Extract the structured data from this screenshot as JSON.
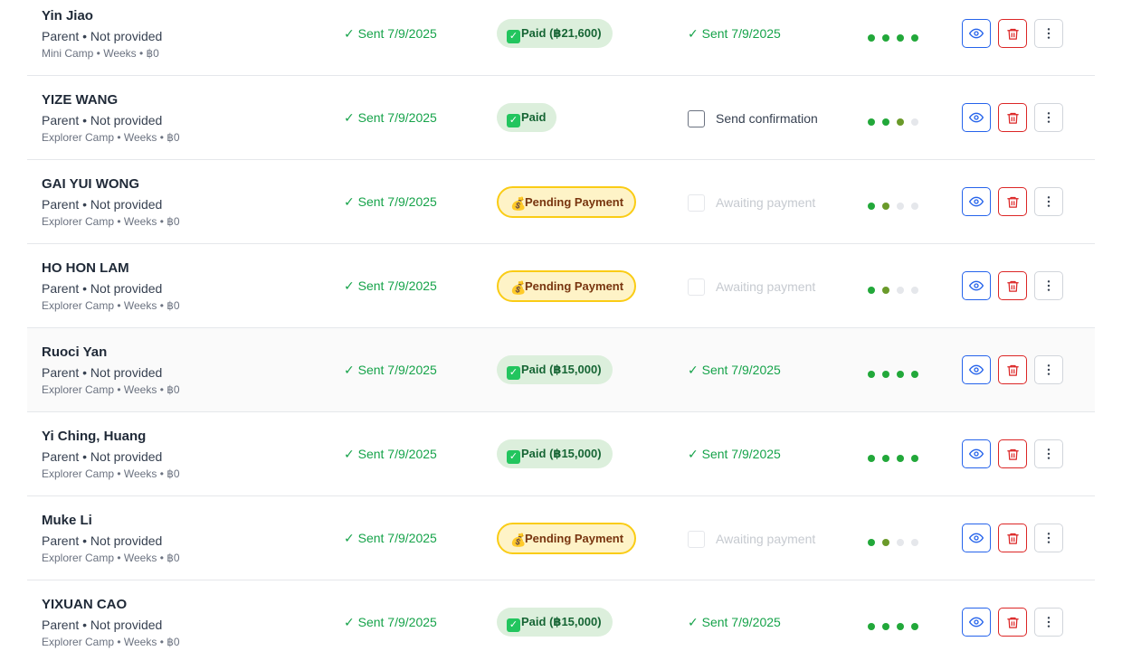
{
  "colors": {
    "success": "#16a34a",
    "paid_bg": "#dcefdc",
    "pending_bg": "#fef3c7",
    "pending_border": "#facc15",
    "view_blue": "#2563eb",
    "delete_red": "#dc2626"
  },
  "icons": {
    "view": "eye-icon",
    "delete": "trash-icon",
    "more": "more-vertical-icon",
    "paid": "check-box-emoji",
    "pending": "money-bag-emoji"
  },
  "rows": [
    {
      "name": "Yin Jiao",
      "contact": "Parent • Not provided",
      "meta": "Mini Camp • Weeks • ฿0",
      "sent": "✓ Sent 7/9/2025",
      "payment": {
        "status": "paid",
        "icon": "✓",
        "label": "Paid (฿21,600)"
      },
      "confirmation": {
        "state": "sent",
        "label": "✓ Sent 7/9/2025"
      },
      "progress": [
        "on",
        "on",
        "on",
        "on"
      ]
    },
    {
      "name": "YIZE WANG",
      "contact": "Parent • Not provided",
      "meta": "Explorer Camp • Weeks • ฿0",
      "sent": "✓ Sent 7/9/2025",
      "payment": {
        "status": "paid",
        "icon": "✓",
        "label": "Paid"
      },
      "confirmation": {
        "state": "action",
        "label": "Send confirmation"
      },
      "progress": [
        "on",
        "on",
        "olive",
        "off"
      ]
    },
    {
      "name": "GAI YUI WONG",
      "contact": "Parent • Not provided",
      "meta": "Explorer Camp • Weeks • ฿0",
      "sent": "✓ Sent 7/9/2025",
      "payment": {
        "status": "pending",
        "icon": "💰",
        "label": "Pending Payment"
      },
      "confirmation": {
        "state": "await",
        "label": "Awaiting payment"
      },
      "progress": [
        "on",
        "olive",
        "off",
        "off"
      ]
    },
    {
      "name": "HO HON LAM",
      "contact": "Parent • Not provided",
      "meta": "Explorer Camp • Weeks • ฿0",
      "sent": "✓ Sent 7/9/2025",
      "payment": {
        "status": "pending",
        "icon": "💰",
        "label": "Pending Payment"
      },
      "confirmation": {
        "state": "await",
        "label": "Awaiting payment"
      },
      "progress": [
        "on",
        "olive",
        "off",
        "off"
      ]
    },
    {
      "name": "Ruoci Yan",
      "contact": "Parent • Not provided",
      "meta": "Explorer Camp • Weeks • ฿0",
      "sent": "✓ Sent 7/9/2025",
      "payment": {
        "status": "paid",
        "icon": "✓",
        "label": "Paid (฿15,000)"
      },
      "confirmation": {
        "state": "sent",
        "label": "✓ Sent 7/9/2025"
      },
      "progress": [
        "on",
        "on",
        "on",
        "on"
      ],
      "highlighted": true
    },
    {
      "name": "Yi Ching, Huang",
      "contact": "Parent • Not provided",
      "meta": "Explorer Camp • Weeks • ฿0",
      "sent": "✓ Sent 7/9/2025",
      "payment": {
        "status": "paid",
        "icon": "✓",
        "label": "Paid (฿15,000)"
      },
      "confirmation": {
        "state": "sent",
        "label": "✓ Sent 7/9/2025"
      },
      "progress": [
        "on",
        "on",
        "on",
        "on"
      ]
    },
    {
      "name": "Muke Li",
      "contact": "Parent • Not provided",
      "meta": "Explorer Camp • Weeks • ฿0",
      "sent": "✓ Sent 7/9/2025",
      "payment": {
        "status": "pending",
        "icon": "💰",
        "label": "Pending Payment"
      },
      "confirmation": {
        "state": "await",
        "label": "Awaiting payment"
      },
      "progress": [
        "on",
        "olive",
        "off",
        "off"
      ]
    },
    {
      "name": "YIXUAN CAO",
      "contact": "Parent • Not provided",
      "meta": "Explorer Camp • Weeks • ฿0",
      "sent": "✓ Sent 7/9/2025",
      "payment": {
        "status": "paid",
        "icon": "✓",
        "label": "Paid (฿15,000)"
      },
      "confirmation": {
        "state": "sent",
        "label": "✓ Sent 7/9/2025"
      },
      "progress": [
        "on",
        "on",
        "on",
        "on"
      ]
    }
  ]
}
